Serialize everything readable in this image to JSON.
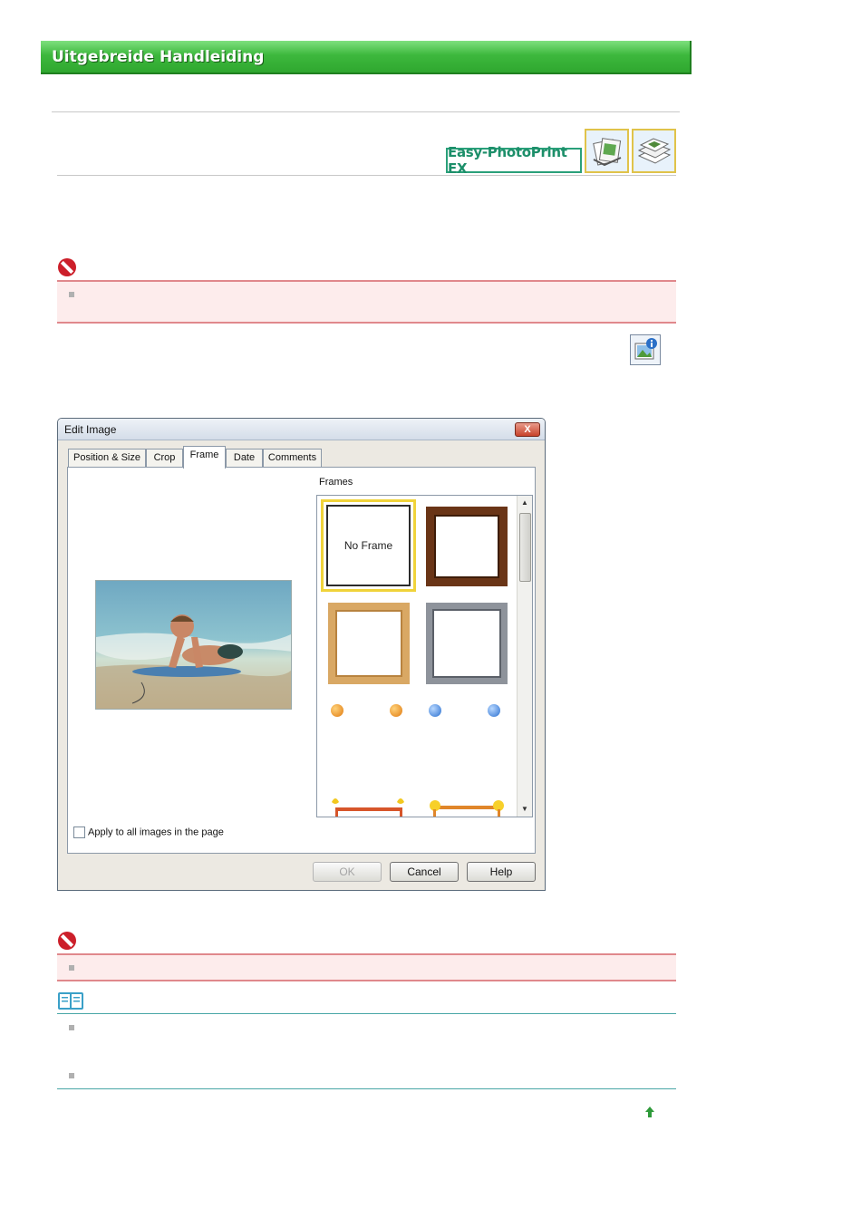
{
  "header": {
    "title": "Uitgebreide Handleiding"
  },
  "product": {
    "logo_text": "Easy-PhotoPrint EX"
  },
  "dialog": {
    "title": "Edit Image",
    "close_label": "X",
    "tabs": [
      "Position & Size",
      "Crop",
      "Frame",
      "Date",
      "Comments"
    ],
    "active_tab": "Frame",
    "frames_label": "Frames",
    "no_frame_label": "No Frame",
    "apply_all_label": "Apply to all images in the page",
    "buttons": {
      "ok": "OK",
      "cancel": "Cancel",
      "help": "Help"
    }
  },
  "colors": {
    "banner_green": "#3db83d",
    "caution_red": "#e0888c",
    "caution_bg": "#fdecec",
    "note_teal": "#4aa7a7",
    "logo_teal": "#1d8f6a"
  },
  "icons": [
    "prohibited-icon",
    "note-book-icon",
    "image-info-icon",
    "back-to-top-arrow-icon",
    "album-app-icon",
    "layout-print-app-icon"
  ]
}
